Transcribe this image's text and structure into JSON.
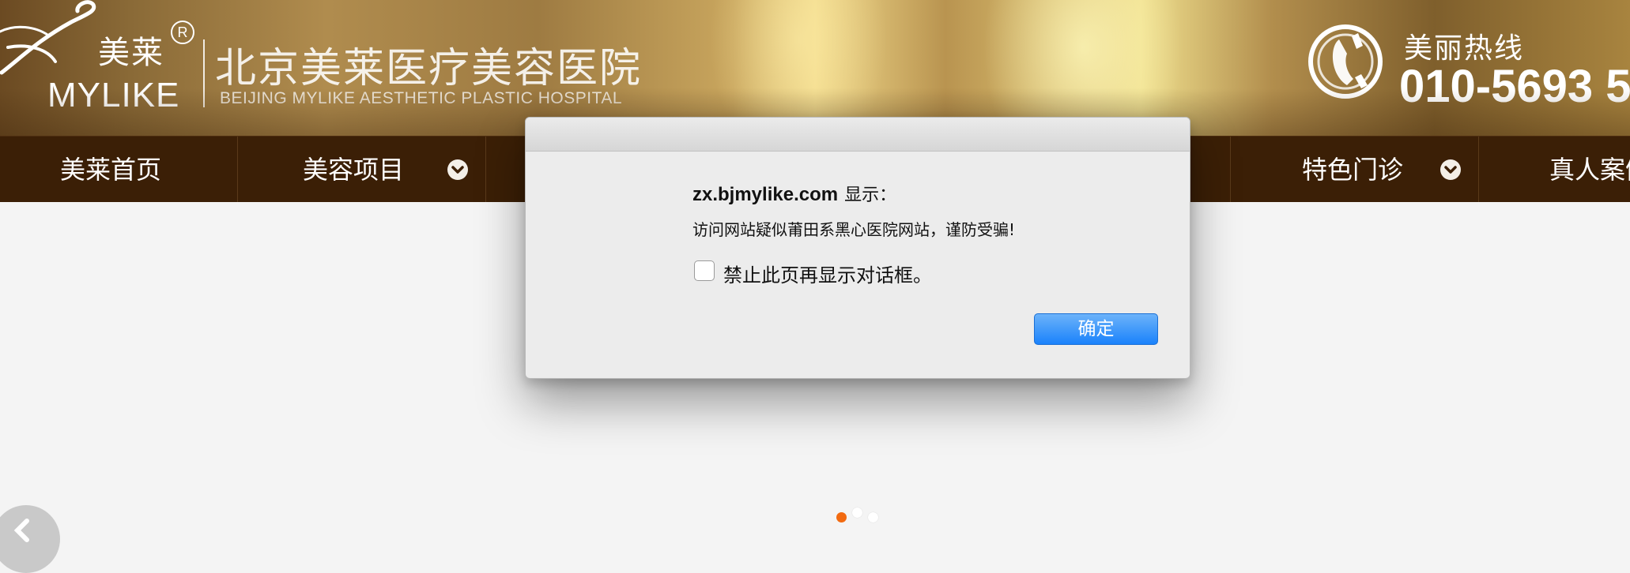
{
  "header": {
    "logo_cn": "美莱",
    "logo_registered": "R",
    "logo_en": "MYLIKE",
    "hospital_name": "北京美莱医疗美容医院",
    "hospital_name_en": "BEIJING MYLIKE AESTHETIC PLASTIC HOSPITAL",
    "hotline_label": "美丽热线",
    "hotline_number": "010-5693 5"
  },
  "nav": {
    "items": [
      {
        "label": "美莱首页"
      },
      {
        "label": "美容项目"
      },
      {
        "label": "特色门诊"
      },
      {
        "label": "真人案例"
      }
    ]
  },
  "dialog": {
    "host": "zx.bjmylike.com",
    "host_suffix": "显示：",
    "message": "访问网站疑似莆田系黑心医院网站，谨防受骗!",
    "checkbox_label": "禁止此页再显示对话框。",
    "checkbox_checked": false,
    "ok_label": "确定"
  },
  "slider": {
    "dot_count": 3,
    "active_dot": 1
  },
  "colors": {
    "nav_bg": "#3b1f06",
    "button_blue": "#1a82fb",
    "active_dot": "#f26a10"
  }
}
